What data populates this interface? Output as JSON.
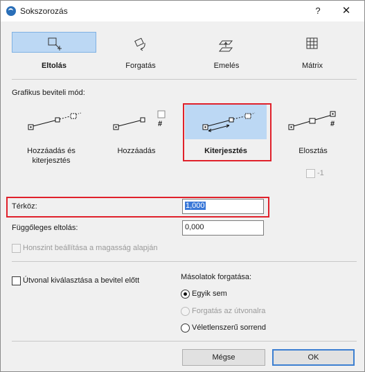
{
  "window": {
    "title": "Sokszorozás",
    "help_label": "?",
    "close_label": "✕"
  },
  "tabs": [
    {
      "label": "Eltolás",
      "icon": "move-icon",
      "active": true
    },
    {
      "label": "Forgatás",
      "icon": "rotate-icon",
      "active": false
    },
    {
      "label": "Emelés",
      "icon": "elevate-icon",
      "active": false
    },
    {
      "label": "Mátrix",
      "icon": "matrix-icon",
      "active": false
    }
  ],
  "input_mode": {
    "label": "Grafikus beviteli mód:",
    "modes": [
      {
        "label": "Hozzáadás és kiterjesztés",
        "selected": false
      },
      {
        "label": "Hozzáadás",
        "selected": false,
        "marker": "#"
      },
      {
        "label": "Kiterjesztés",
        "selected": true
      },
      {
        "label": "Elosztás",
        "selected": false,
        "marker": "#"
      }
    ],
    "minus_one_label": "-1"
  },
  "fields": {
    "spacing_label": "Térköz:",
    "spacing_value": "1,000",
    "vertical_offset_label": "Függőleges eltolás:",
    "vertical_offset_value": "0,000",
    "story_checkbox_label": "Honszint beállítása a magasság alapján"
  },
  "path_checkbox_label": "Útvonal kiválasztása a bevitel előtt",
  "rotation": {
    "label": "Másolatok forgatása:",
    "options": [
      {
        "label": "Egyik sem",
        "checked": true,
        "disabled": false
      },
      {
        "label": "Forgatás az útvonalra",
        "checked": false,
        "disabled": true
      },
      {
        "label": "Véletlenszerű sorrend",
        "checked": false,
        "disabled": false
      }
    ]
  },
  "buttons": {
    "cancel": "Mégse",
    "ok": "OK"
  },
  "colors": {
    "selected_bg": "#bcd8f4",
    "highlight_border": "#e0202a",
    "text_selection": "#3a78d8"
  }
}
